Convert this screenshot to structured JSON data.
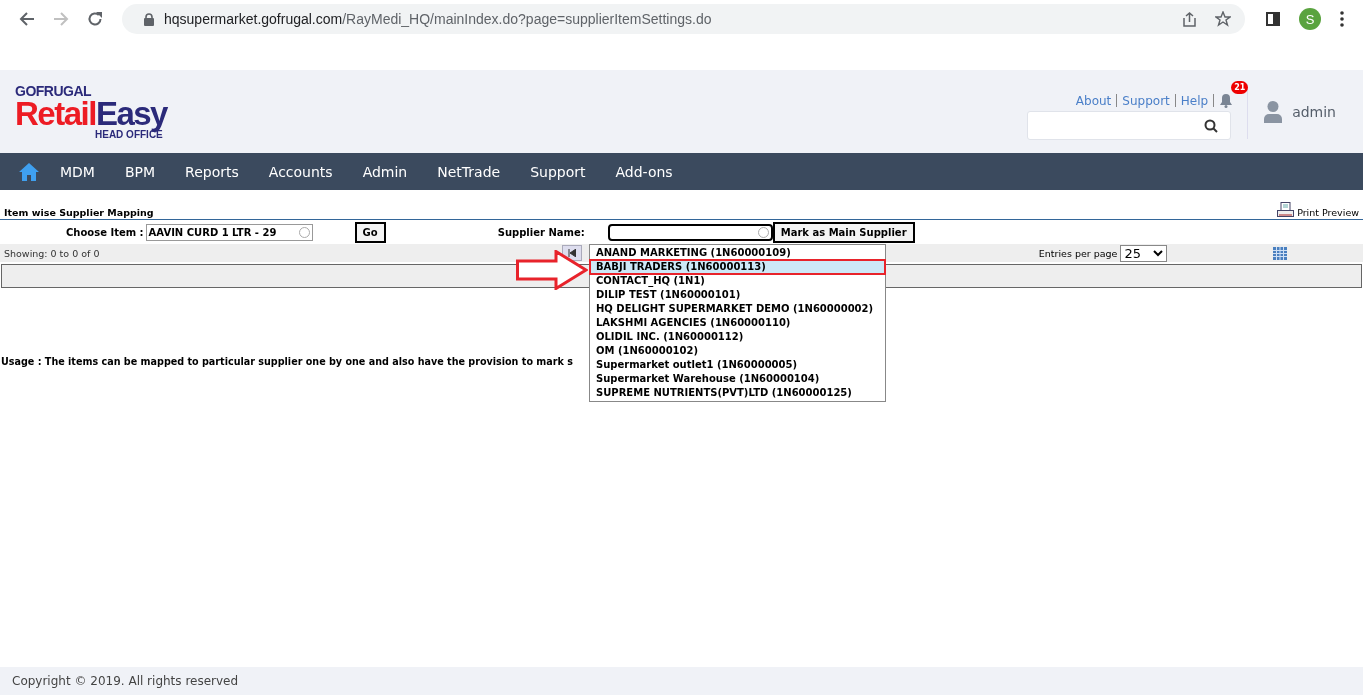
{
  "browser": {
    "url_host": "hqsupermarket.gofrugal.com",
    "url_path": "/RayMedi_HQ/mainIndex.do?page=supplierItemSettings.do",
    "profile_initial": "S"
  },
  "header": {
    "brand": "GOFRUGAL",
    "product": [
      "Retail",
      "Easy"
    ],
    "subtitle": "HEAD OFFICE",
    "links": [
      "About",
      "Support",
      "Help"
    ],
    "notification_count": "21",
    "user": "admin"
  },
  "nav": {
    "items": [
      "MDM",
      "BPM",
      "Reports",
      "Accounts",
      "Admin",
      "NetTrade",
      "Support",
      "Add-ons"
    ]
  },
  "page": {
    "title": "Item wise Supplier Mapping",
    "print_preview": "Print Preview",
    "choose_item_label": "Choose Item :",
    "choose_item_value": "AAVIN CURD 1 LTR - 29",
    "go_button": "Go",
    "supplier_label": "Supplier Name:",
    "mark_button": "Mark as Main Supplier",
    "showing": "Showing: 0 to 0 of 0",
    "entries_label": "Entries per page",
    "entries_value": "25",
    "usage": "Usage : The items can be mapped to particular supplier one by one and also have the provision to mark s"
  },
  "dropdown": {
    "items": [
      {
        "label": "ANAND MARKETING (1N60000109)",
        "selected": false
      },
      {
        "label": "BABJI TRADERS (1N60000113)",
        "selected": true
      },
      {
        "label": "CONTACT_HQ (1N1)",
        "selected": false
      },
      {
        "label": "DILIP TEST (1N60000101)",
        "selected": false
      },
      {
        "label": "HQ DELIGHT SUPERMARKET DEMO (1N60000002)",
        "selected": false
      },
      {
        "label": "LAKSHMI AGENCIES (1N60000110)",
        "selected": false
      },
      {
        "label": "OLIDIL INC. (1N60000112)",
        "selected": false
      },
      {
        "label": "OM (1N60000102)",
        "selected": false
      },
      {
        "label": "Supermarket outlet1 (1N60000005)",
        "selected": false
      },
      {
        "label": "Supermarket Warehouse (1N60000104)",
        "selected": false
      },
      {
        "label": "SUPREME NUTRIENTS(PVT)LTD (1N60000125)",
        "selected": false
      }
    ]
  },
  "footer": {
    "copyright": "Copyright © 2019. All rights reserved"
  }
}
